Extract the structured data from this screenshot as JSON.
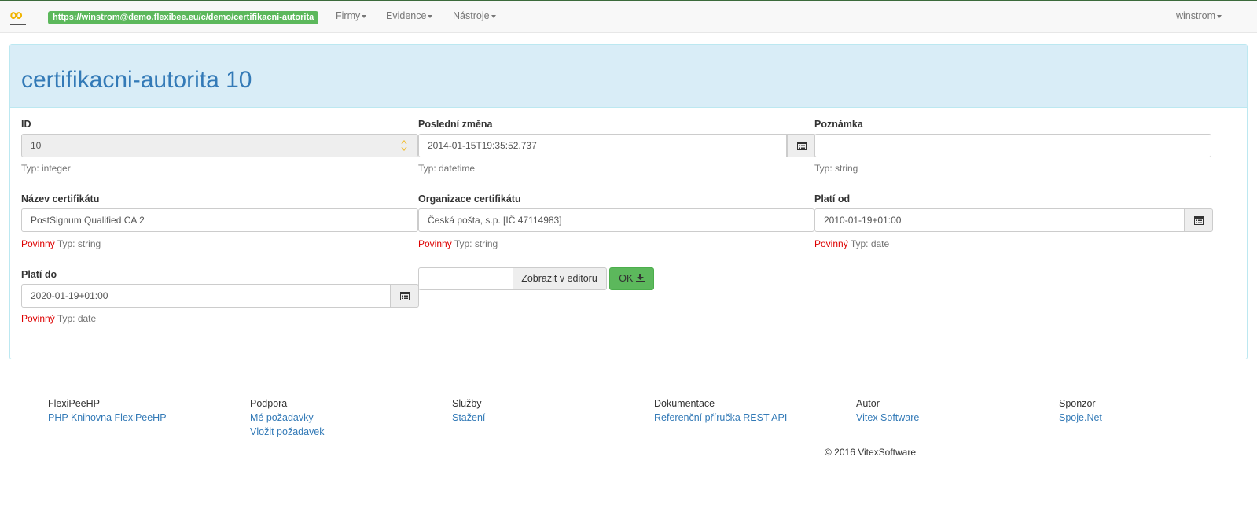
{
  "navbar": {
    "url": "https://winstrom@demo.flexibee.eu/c/demo/certifikacni-autorita",
    "menus": [
      "Firmy",
      "Evidence",
      "Nástroje"
    ],
    "user": "winstrom"
  },
  "page": {
    "title": "certifikacni-autorita 10"
  },
  "fields": {
    "id": {
      "label": "ID",
      "value": "10",
      "type": "Typ: integer"
    },
    "posledni_zmena": {
      "label": "Poslední změna",
      "value": "2014-01-15T19:35:52.737",
      "type": "Typ: datetime"
    },
    "poznamka": {
      "label": "Poznámka",
      "value": "",
      "type": "Typ: string"
    },
    "nazev_certifikatu": {
      "label": "Název certifikátu",
      "value": "PostSignum Qualified CA 2",
      "required": "Povinný",
      "type": "Typ: string"
    },
    "organizace_certifikatu": {
      "label": "Organizace certifikátu",
      "value": "Česká pošta, s.p. [IČ 47114983]",
      "required": "Povinný",
      "type": "Typ: string"
    },
    "plati_od": {
      "label": "Platí od",
      "value": "2010-01-19+01:00",
      "required": "Povinný",
      "type": "Typ: date"
    },
    "plati_do": {
      "label": "Platí do",
      "value": "2020-01-19+01:00",
      "required": "Povinný",
      "type": "Typ: date"
    }
  },
  "editor": {
    "button_label": "Zobrazit v editoru",
    "ok_label": "OK"
  },
  "footer": {
    "columns": [
      {
        "heading": "FlexiPeeHP",
        "links": [
          "PHP Knihovna FlexiPeeHP"
        ]
      },
      {
        "heading": "Podpora",
        "links": [
          "Mé požadavky",
          "Vložit požadavek"
        ]
      },
      {
        "heading": "Služby",
        "links": [
          "Stažení"
        ]
      },
      {
        "heading": "Dokumentace",
        "links": [
          "Referenční příručka REST API"
        ]
      },
      {
        "heading": "Autor",
        "links": [
          "Vitex Software"
        ]
      },
      {
        "heading": "Sponzor",
        "links": [
          "Spoje.Net"
        ]
      }
    ],
    "copyright": "© 2016 VitexSoftware"
  },
  "colors": {
    "brand_green": "#5cb85c",
    "panel_heading_bg": "#d9edf7",
    "title_blue": "#337ab7",
    "required_red": "#dd0000"
  },
  "icons": [
    "flexibee-logo-icon",
    "calendar-icon",
    "download-icon",
    "spinner-arrows-icon",
    "caret-down-icon"
  ]
}
